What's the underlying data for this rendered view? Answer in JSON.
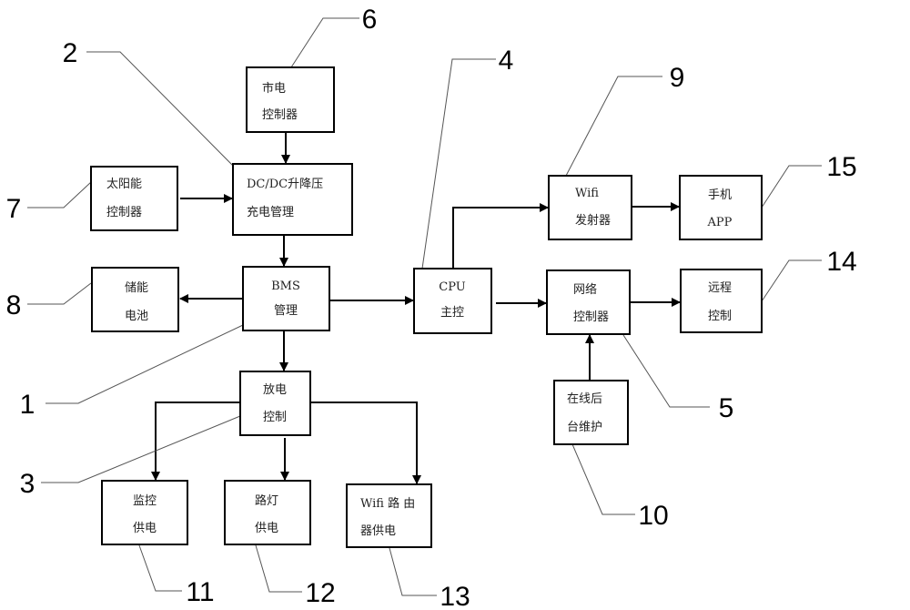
{
  "diagram": {
    "blocks": [
      {
        "id": "mains-controller",
        "lines": [
          "市电",
          "控制器"
        ]
      },
      {
        "id": "dcdc-charge",
        "lines": [
          "DC/DC升降压",
          "充电管理"
        ]
      },
      {
        "id": "solar-controller",
        "lines": [
          "太阳能",
          "控制器"
        ]
      },
      {
        "id": "bms",
        "lines": [
          "BMS",
          "管理"
        ]
      },
      {
        "id": "storage-battery",
        "lines": [
          "储能",
          "电池"
        ]
      },
      {
        "id": "discharge-control",
        "lines": [
          "放电",
          "控制"
        ]
      },
      {
        "id": "monitor-power",
        "lines": [
          "监控",
          "供电"
        ]
      },
      {
        "id": "streetlight-power",
        "lines": [
          "路灯",
          "供电"
        ]
      },
      {
        "id": "wifi-router-power",
        "lines": [
          "Wifi 路 由",
          "器供电"
        ]
      },
      {
        "id": "cpu-main",
        "lines": [
          "CPU",
          "主控"
        ]
      },
      {
        "id": "wifi-transmitter",
        "lines": [
          "Wifi",
          "发射器"
        ]
      },
      {
        "id": "phone-app",
        "lines": [
          "手机",
          "APP"
        ]
      },
      {
        "id": "network-controller",
        "lines": [
          "网络",
          "控制器"
        ]
      },
      {
        "id": "remote-control",
        "lines": [
          "远程",
          "控制"
        ]
      },
      {
        "id": "online-maintenance",
        "lines": [
          "在线后",
          "台维护"
        ]
      }
    ],
    "reference_numbers": [
      {
        "target": "bms",
        "label": "1"
      },
      {
        "target": "dcdc-charge",
        "label": "2"
      },
      {
        "target": "discharge-control",
        "label": "3"
      },
      {
        "target": "cpu-main",
        "label": "4"
      },
      {
        "target": "network-controller",
        "label": "5"
      },
      {
        "target": "mains-controller",
        "label": "6"
      },
      {
        "target": "solar-controller",
        "label": "7"
      },
      {
        "target": "storage-battery",
        "label": "8"
      },
      {
        "target": "wifi-transmitter",
        "label": "9"
      },
      {
        "target": "online-maintenance",
        "label": "10"
      },
      {
        "target": "monitor-power",
        "label": "11"
      },
      {
        "target": "streetlight-power",
        "label": "12"
      },
      {
        "target": "wifi-router-power",
        "label": "13"
      },
      {
        "target": "remote-control",
        "label": "14"
      },
      {
        "target": "phone-app",
        "label": "15"
      }
    ],
    "connections": [
      {
        "from": "mains-controller",
        "to": "dcdc-charge"
      },
      {
        "from": "solar-controller",
        "to": "dcdc-charge"
      },
      {
        "from": "dcdc-charge",
        "to": "bms"
      },
      {
        "from": "bms",
        "to": "storage-battery"
      },
      {
        "from": "bms",
        "to": "cpu-main"
      },
      {
        "from": "bms",
        "to": "discharge-control"
      },
      {
        "from": "discharge-control",
        "to": "monitor-power"
      },
      {
        "from": "discharge-control",
        "to": "streetlight-power"
      },
      {
        "from": "discharge-control",
        "to": "wifi-router-power"
      },
      {
        "from": "cpu-main",
        "to": "wifi-transmitter"
      },
      {
        "from": "cpu-main",
        "to": "network-controller"
      },
      {
        "from": "wifi-transmitter",
        "to": "phone-app"
      },
      {
        "from": "network-controller",
        "to": "remote-control"
      },
      {
        "from": "online-maintenance",
        "to": "network-controller"
      }
    ]
  }
}
